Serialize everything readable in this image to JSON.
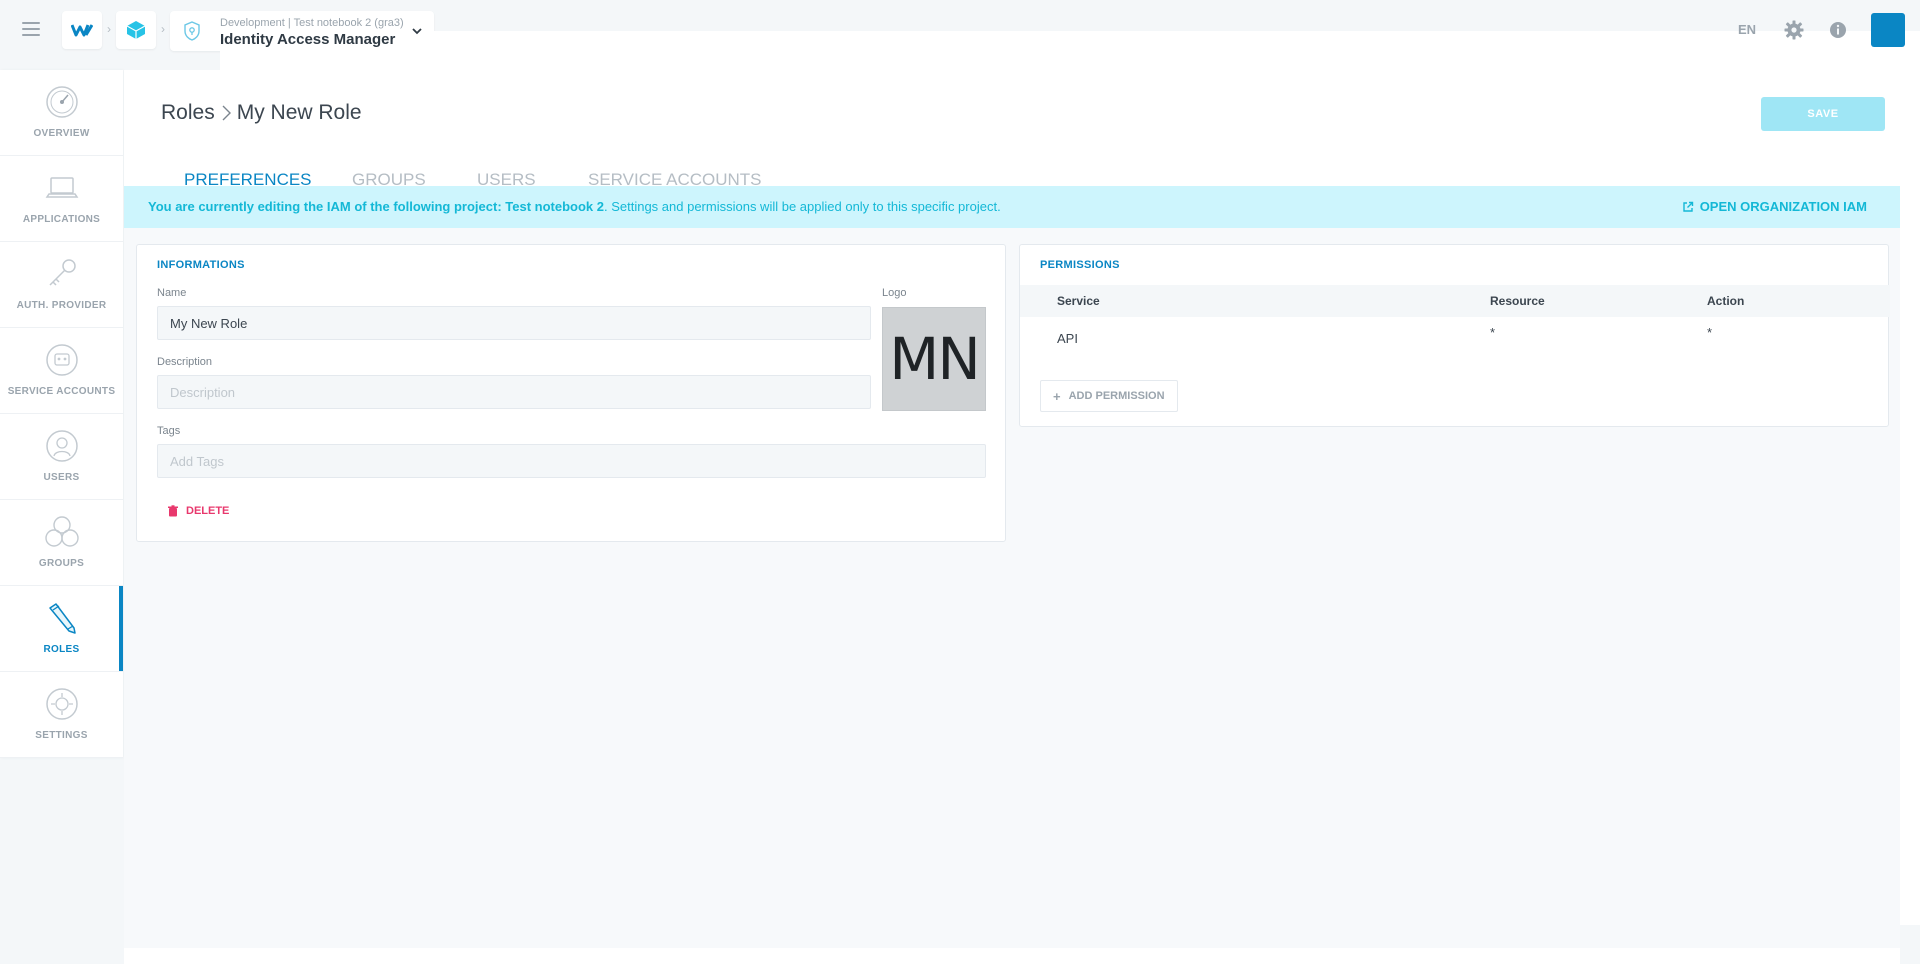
{
  "colors": {
    "accent": "#0a86c4",
    "banner_bg": "#cdf5fd",
    "banner_text": "#14b8d6",
    "danger": "#e8386d",
    "save_disabled": "#9fe6f5"
  },
  "header": {
    "context_line": "Development | Test notebook 2 (gra3)",
    "app_name": "Identity Access Manager",
    "language": "EN",
    "icons": [
      "menu-icon",
      "forepaas-logo-icon",
      "cube-icon",
      "iam-shield-icon",
      "chevron-down-icon",
      "gear-icon",
      "info-icon",
      "user-avatar"
    ]
  },
  "sidebar": {
    "items": [
      {
        "label": "OVERVIEW",
        "icon": "dashboard-gauge-icon"
      },
      {
        "label": "APPLICATIONS",
        "icon": "laptop-icon"
      },
      {
        "label": "AUTH. PROVIDER",
        "icon": "key-icon"
      },
      {
        "label": "SERVICE ACCOUNTS",
        "icon": "robot-icon"
      },
      {
        "label": "USERS",
        "icon": "user-icon"
      },
      {
        "label": "GROUPS",
        "icon": "group-icon"
      },
      {
        "label": "ROLES",
        "icon": "pencil-icon"
      },
      {
        "label": "SETTINGS",
        "icon": "settings-icon"
      }
    ],
    "active": "ROLES"
  },
  "page": {
    "breadcrumb_root": "Roles",
    "breadcrumb_current": "My New Role",
    "save_label": "SAVE",
    "tabs": [
      {
        "label": "PREFERENCES",
        "active": true
      },
      {
        "label": "GROUPS",
        "active": false
      },
      {
        "label": "USERS",
        "active": false
      },
      {
        "label": "SERVICE ACCOUNTS",
        "active": false
      }
    ]
  },
  "banner": {
    "bold_text": "You are currently editing the IAM of the following project: Test notebook 2",
    "rest_text": ". Settings and permissions will be applied only to this specific project.",
    "link_label": "OPEN ORGANIZATION IAM"
  },
  "informations": {
    "title": "INFORMATIONS",
    "name_label": "Name",
    "name_value": "My New Role",
    "logo_label": "Logo",
    "logo_initials": "MN",
    "description_label": "Description",
    "description_placeholder": "Description",
    "tags_label": "Tags",
    "tags_placeholder": "Add Tags",
    "delete_label": "DELETE"
  },
  "permissions": {
    "title": "PERMISSIONS",
    "columns": [
      "Service",
      "Resource",
      "Action"
    ],
    "rows": [
      {
        "service": "API",
        "resource": "*",
        "action": "*"
      }
    ],
    "add_label": "ADD PERMISSION"
  }
}
